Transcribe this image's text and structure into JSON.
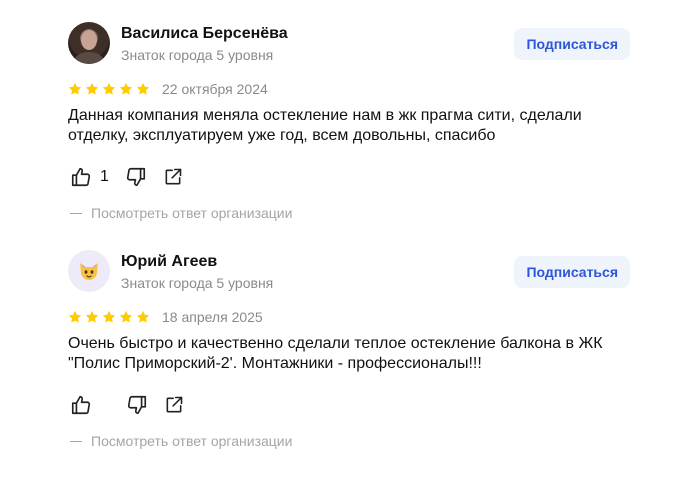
{
  "reviews": [
    {
      "author": "Василиса Берсенёва",
      "level": "Знаток города 5 уровня",
      "subscribe_label": "Подписаться",
      "rating": 5,
      "date": "22 октября 2024",
      "text": "Данная компания меняла остекление нам в жк прагма сити, сделали отделку, эксплуатируем уже год, всем довольны, спасибо",
      "likes": "1",
      "org_reply_label": "Посмотреть ответ организации",
      "avatar": "user-photo"
    },
    {
      "author": "Юрий Агеев",
      "level": "Знаток города 5 уровня",
      "subscribe_label": "Подписаться",
      "rating": 5,
      "date": "18 апреля 2025",
      "text": "Очень быстро и качественно сделали теплое остекление балкона в ЖК \"Полис Приморский-2'. Монтажники - профессионалы!!!",
      "likes": "",
      "org_reply_label": "Посмотреть ответ организации",
      "avatar": "cat-emoji"
    }
  ],
  "colors": {
    "star": "#fc0",
    "subscribe_bg": "#eef3fc",
    "subscribe_text": "#2c57d6",
    "muted_text": "#8a8a8a"
  },
  "icons": [
    "thumbs-up-icon",
    "thumbs-down-icon",
    "share-icon",
    "star-icon"
  ]
}
